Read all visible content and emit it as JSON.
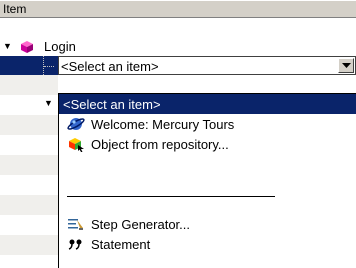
{
  "header": {
    "title": "Item"
  },
  "tree": {
    "login_label": "Login",
    "combo_value": "<Select an item>"
  },
  "dropdown": {
    "options": [
      {
        "label": "<Select an item>",
        "icon": "none",
        "selected": true
      },
      {
        "label": "Welcome: Mercury Tours",
        "icon": "globe-icon",
        "selected": false
      },
      {
        "label": "Object from repository...",
        "icon": "object-repository-icon",
        "selected": false
      },
      {
        "label": "Step Generator...",
        "icon": "step-generator-icon",
        "selected": false
      },
      {
        "label": "Statement",
        "icon": "statement-icon",
        "selected": false
      }
    ]
  },
  "colors": {
    "selection": "#0a246a",
    "chrome": "#d4d0c8"
  }
}
